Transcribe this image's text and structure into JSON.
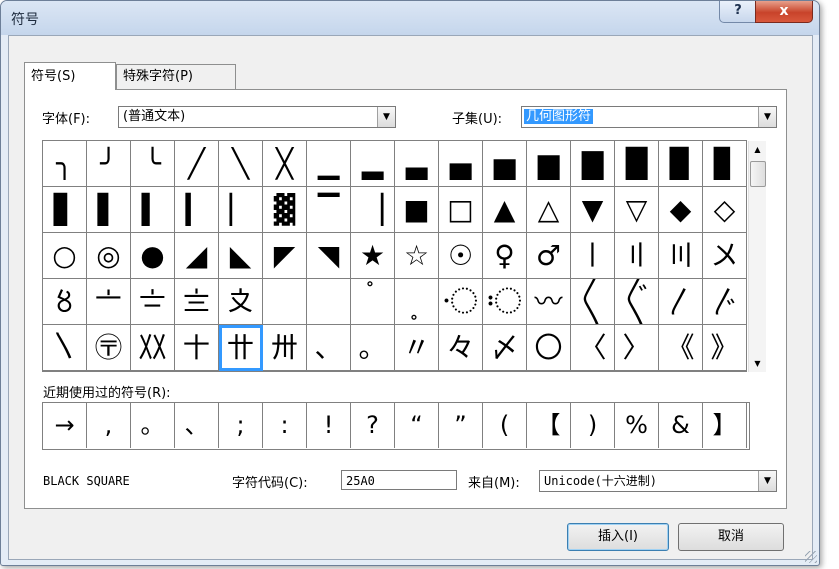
{
  "window": {
    "title": "符号",
    "help_label": "?",
    "close_label": "x"
  },
  "tabs": [
    {
      "label": "符号(S)"
    },
    {
      "label": "特殊字符(P)"
    }
  ],
  "font": {
    "label": "字体(F):",
    "value": "(普通文本)"
  },
  "subset": {
    "label": "子集(U):",
    "value": "几何图形符"
  },
  "symbol_grid": {
    "selected_index": 68,
    "cells": [
      "╮",
      "╯",
      "╰",
      "╱",
      "╲",
      "╳",
      "▁",
      "▂",
      "▃",
      "▄",
      "▅",
      "▆",
      "▇",
      "█",
      "▉",
      "▊",
      "▋",
      "▌",
      "▍",
      "▎",
      "▏",
      "▓",
      "▔",
      "▕",
      "■",
      "□",
      "▲",
      "△",
      "▼",
      "▽",
      "◆",
      "◇",
      "○",
      "◎",
      "●",
      "◢",
      "◣",
      "◤",
      "◥",
      "★",
      "☆",
      "☉",
      "♀",
      "♂",
      "〡",
      "〢",
      "〣",
      "〤",
      "〥",
      "〦",
      "〧",
      "〨",
      "〩",
      "〪",
      "〫",
      "〬",
      "〭",
      "〮",
      "〯",
      "〰",
      "〱",
      "〲",
      "〳",
      "〴",
      "〵",
      "〶",
      "〷",
      "〸",
      "〹",
      "〺",
      "、",
      "。",
      "〃",
      "々",
      "〆",
      "〇",
      "〈",
      "〉",
      "《",
      "》"
    ]
  },
  "recent": {
    "label": "近期使用过的符号(R):",
    "symbols": [
      "→",
      ",",
      "。",
      "、",
      ";",
      ":",
      "!",
      "?",
      "“",
      "”",
      "(",
      "【",
      ")",
      "%",
      "&",
      "】"
    ]
  },
  "char_name": "BLACK SQUARE",
  "char_code": {
    "label": "字符代码(C):",
    "value": "25A0"
  },
  "from": {
    "label": "来自(M):",
    "value": "Unicode(十六进制)"
  },
  "buttons": {
    "insert": "插入(I)",
    "cancel": "取消"
  }
}
